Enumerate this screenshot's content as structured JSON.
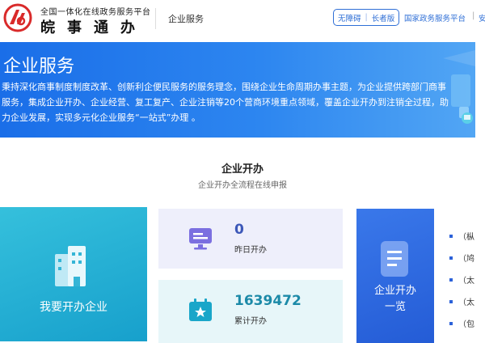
{
  "header": {
    "brand_sub": "全国一体化在线政务服务平台",
    "brand_main": "皖事通办",
    "section": "企业服务",
    "access_barrier_free": "无障碍",
    "access_elderly": "长者版",
    "national_platform": "国家政务服务平台",
    "more": "安"
  },
  "banner": {
    "title": "企业服务",
    "description": "秉持深化商事制度制度改革、创新利企便民服务的服务理念，围绕企业生命周期办事主题，为企业提供跨部门商事服务，集成企业开办、企业经营、复工复产、企业注销等20个营商环境重点领域，覆盖企业开办到注销全过程，助力企业发展，实现多元化企业服务“一站式”办理 。"
  },
  "section": {
    "title": "企业开办",
    "subtitle": "企业开办全流程在线申报"
  },
  "cards": {
    "open_company": "我要开办企业",
    "yesterday": {
      "value": "0",
      "label": "昨日开办"
    },
    "total": {
      "value": "1639472",
      "label": "累计开办"
    },
    "list_label_1": "企业开办",
    "list_label_2": "一览"
  },
  "list_items": [
    "（枞",
    "（鸠",
    "（太",
    "（太",
    "（包"
  ],
  "colors": {
    "accent": "#2f6fd6",
    "banner": "#1a6ee8",
    "open_card": "#1fa8d2",
    "list_card": "#2c66dd"
  }
}
